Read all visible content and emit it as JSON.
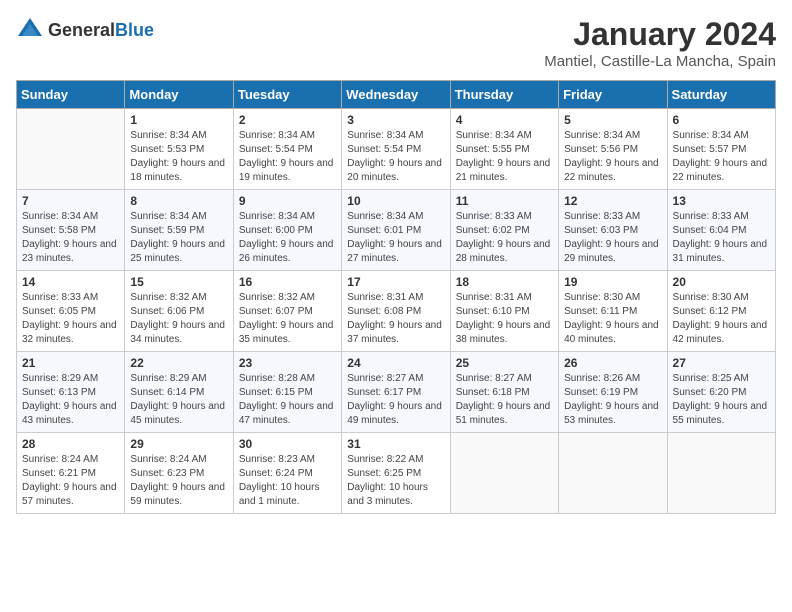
{
  "header": {
    "logo_general": "General",
    "logo_blue": "Blue",
    "month_title": "January 2024",
    "location": "Mantiel, Castille-La Mancha, Spain"
  },
  "weekdays": [
    "Sunday",
    "Monday",
    "Tuesday",
    "Wednesday",
    "Thursday",
    "Friday",
    "Saturday"
  ],
  "weeks": [
    [
      {
        "day": "",
        "sunrise": "",
        "sunset": "",
        "daylight": ""
      },
      {
        "day": "1",
        "sunrise": "Sunrise: 8:34 AM",
        "sunset": "Sunset: 5:53 PM",
        "daylight": "Daylight: 9 hours and 18 minutes."
      },
      {
        "day": "2",
        "sunrise": "Sunrise: 8:34 AM",
        "sunset": "Sunset: 5:54 PM",
        "daylight": "Daylight: 9 hours and 19 minutes."
      },
      {
        "day": "3",
        "sunrise": "Sunrise: 8:34 AM",
        "sunset": "Sunset: 5:54 PM",
        "daylight": "Daylight: 9 hours and 20 minutes."
      },
      {
        "day": "4",
        "sunrise": "Sunrise: 8:34 AM",
        "sunset": "Sunset: 5:55 PM",
        "daylight": "Daylight: 9 hours and 21 minutes."
      },
      {
        "day": "5",
        "sunrise": "Sunrise: 8:34 AM",
        "sunset": "Sunset: 5:56 PM",
        "daylight": "Daylight: 9 hours and 22 minutes."
      },
      {
        "day": "6",
        "sunrise": "Sunrise: 8:34 AM",
        "sunset": "Sunset: 5:57 PM",
        "daylight": "Daylight: 9 hours and 22 minutes."
      }
    ],
    [
      {
        "day": "7",
        "sunrise": "Sunrise: 8:34 AM",
        "sunset": "Sunset: 5:58 PM",
        "daylight": "Daylight: 9 hours and 23 minutes."
      },
      {
        "day": "8",
        "sunrise": "Sunrise: 8:34 AM",
        "sunset": "Sunset: 5:59 PM",
        "daylight": "Daylight: 9 hours and 25 minutes."
      },
      {
        "day": "9",
        "sunrise": "Sunrise: 8:34 AM",
        "sunset": "Sunset: 6:00 PM",
        "daylight": "Daylight: 9 hours and 26 minutes."
      },
      {
        "day": "10",
        "sunrise": "Sunrise: 8:34 AM",
        "sunset": "Sunset: 6:01 PM",
        "daylight": "Daylight: 9 hours and 27 minutes."
      },
      {
        "day": "11",
        "sunrise": "Sunrise: 8:33 AM",
        "sunset": "Sunset: 6:02 PM",
        "daylight": "Daylight: 9 hours and 28 minutes."
      },
      {
        "day": "12",
        "sunrise": "Sunrise: 8:33 AM",
        "sunset": "Sunset: 6:03 PM",
        "daylight": "Daylight: 9 hours and 29 minutes."
      },
      {
        "day": "13",
        "sunrise": "Sunrise: 8:33 AM",
        "sunset": "Sunset: 6:04 PM",
        "daylight": "Daylight: 9 hours and 31 minutes."
      }
    ],
    [
      {
        "day": "14",
        "sunrise": "Sunrise: 8:33 AM",
        "sunset": "Sunset: 6:05 PM",
        "daylight": "Daylight: 9 hours and 32 minutes."
      },
      {
        "day": "15",
        "sunrise": "Sunrise: 8:32 AM",
        "sunset": "Sunset: 6:06 PM",
        "daylight": "Daylight: 9 hours and 34 minutes."
      },
      {
        "day": "16",
        "sunrise": "Sunrise: 8:32 AM",
        "sunset": "Sunset: 6:07 PM",
        "daylight": "Daylight: 9 hours and 35 minutes."
      },
      {
        "day": "17",
        "sunrise": "Sunrise: 8:31 AM",
        "sunset": "Sunset: 6:08 PM",
        "daylight": "Daylight: 9 hours and 37 minutes."
      },
      {
        "day": "18",
        "sunrise": "Sunrise: 8:31 AM",
        "sunset": "Sunset: 6:10 PM",
        "daylight": "Daylight: 9 hours and 38 minutes."
      },
      {
        "day": "19",
        "sunrise": "Sunrise: 8:30 AM",
        "sunset": "Sunset: 6:11 PM",
        "daylight": "Daylight: 9 hours and 40 minutes."
      },
      {
        "day": "20",
        "sunrise": "Sunrise: 8:30 AM",
        "sunset": "Sunset: 6:12 PM",
        "daylight": "Daylight: 9 hours and 42 minutes."
      }
    ],
    [
      {
        "day": "21",
        "sunrise": "Sunrise: 8:29 AM",
        "sunset": "Sunset: 6:13 PM",
        "daylight": "Daylight: 9 hours and 43 minutes."
      },
      {
        "day": "22",
        "sunrise": "Sunrise: 8:29 AM",
        "sunset": "Sunset: 6:14 PM",
        "daylight": "Daylight: 9 hours and 45 minutes."
      },
      {
        "day": "23",
        "sunrise": "Sunrise: 8:28 AM",
        "sunset": "Sunset: 6:15 PM",
        "daylight": "Daylight: 9 hours and 47 minutes."
      },
      {
        "day": "24",
        "sunrise": "Sunrise: 8:27 AM",
        "sunset": "Sunset: 6:17 PM",
        "daylight": "Daylight: 9 hours and 49 minutes."
      },
      {
        "day": "25",
        "sunrise": "Sunrise: 8:27 AM",
        "sunset": "Sunset: 6:18 PM",
        "daylight": "Daylight: 9 hours and 51 minutes."
      },
      {
        "day": "26",
        "sunrise": "Sunrise: 8:26 AM",
        "sunset": "Sunset: 6:19 PM",
        "daylight": "Daylight: 9 hours and 53 minutes."
      },
      {
        "day": "27",
        "sunrise": "Sunrise: 8:25 AM",
        "sunset": "Sunset: 6:20 PM",
        "daylight": "Daylight: 9 hours and 55 minutes."
      }
    ],
    [
      {
        "day": "28",
        "sunrise": "Sunrise: 8:24 AM",
        "sunset": "Sunset: 6:21 PM",
        "daylight": "Daylight: 9 hours and 57 minutes."
      },
      {
        "day": "29",
        "sunrise": "Sunrise: 8:24 AM",
        "sunset": "Sunset: 6:23 PM",
        "daylight": "Daylight: 9 hours and 59 minutes."
      },
      {
        "day": "30",
        "sunrise": "Sunrise: 8:23 AM",
        "sunset": "Sunset: 6:24 PM",
        "daylight": "Daylight: 10 hours and 1 minute."
      },
      {
        "day": "31",
        "sunrise": "Sunrise: 8:22 AM",
        "sunset": "Sunset: 6:25 PM",
        "daylight": "Daylight: 10 hours and 3 minutes."
      },
      {
        "day": "",
        "sunrise": "",
        "sunset": "",
        "daylight": ""
      },
      {
        "day": "",
        "sunrise": "",
        "sunset": "",
        "daylight": ""
      },
      {
        "day": "",
        "sunrise": "",
        "sunset": "",
        "daylight": ""
      }
    ]
  ]
}
